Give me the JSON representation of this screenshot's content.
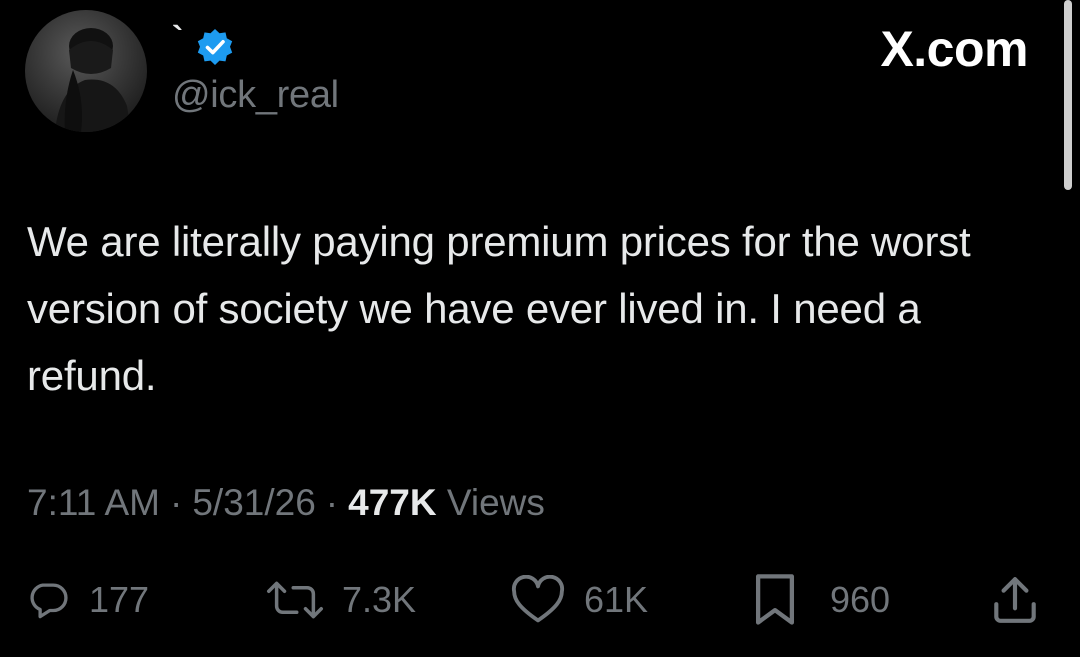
{
  "author": {
    "display_name": "`",
    "handle": "@ick_real",
    "verified_icon": "verified-badge-icon"
  },
  "site": {
    "logo_text": "X.com"
  },
  "tweet": {
    "text": "We are literally paying premium prices for the worst version of society we have ever lived in. I need a refund.",
    "time": "7:11 AM",
    "date": "5/31/26",
    "views_count": "477K",
    "views_label": "Views",
    "separator": "·"
  },
  "actions": {
    "replies": "177",
    "reposts": "7.3K",
    "likes": "61K",
    "bookmarks": "960"
  },
  "colors": {
    "background": "#000000",
    "text_primary": "#e7e9ea",
    "text_secondary": "#71767b",
    "verified_blue": "#1d9bf0"
  }
}
